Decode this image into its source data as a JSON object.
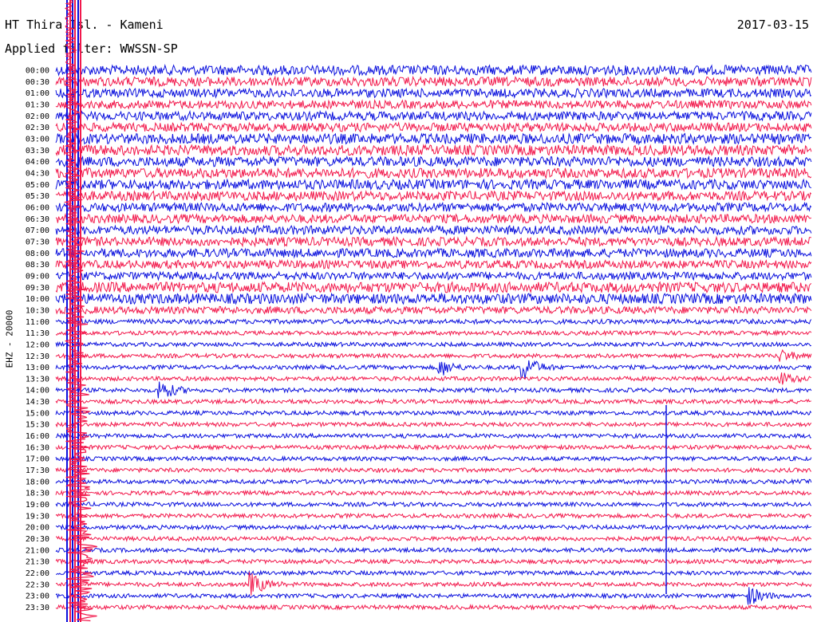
{
  "header": {
    "station": "HT Thira Isl. - Kameni",
    "date": "2017-03-15",
    "filter": "Applied filter: WWSSN-SP"
  },
  "chart_data": {
    "type": "line",
    "channel_label": "EHZ - 20000",
    "row_labels": [
      "00:00",
      "00:30",
      "01:00",
      "01:30",
      "02:00",
      "02:30",
      "03:00",
      "03:30",
      "04:00",
      "04:30",
      "05:00",
      "05:30",
      "06:00",
      "06:30",
      "07:00",
      "07:30",
      "08:00",
      "08:30",
      "09:00",
      "09:30",
      "10:00",
      "10:30",
      "11:00",
      "11:30",
      "12:00",
      "12:30",
      "13:00",
      "13:30",
      "14:00",
      "14:30",
      "15:00",
      "15:30",
      "16:00",
      "16:30",
      "17:00",
      "17:30",
      "18:00",
      "18:30",
      "19:00",
      "19:30",
      "20:00",
      "20:30",
      "21:00",
      "21:30",
      "22:00",
      "22:30",
      "23:00",
      "23:30"
    ],
    "colors": {
      "even_rows": "#0a10dd",
      "odd_rows": "#f2194c"
    },
    "noise_level": [
      0.95,
      0.9,
      0.85,
      0.8,
      0.85,
      0.85,
      1.0,
      1.0,
      0.95,
      0.95,
      0.95,
      0.9,
      0.85,
      0.85,
      0.85,
      0.85,
      0.85,
      0.8,
      0.75,
      1.0,
      1.0,
      0.7,
      0.45,
      0.4,
      0.4,
      0.4,
      0.4,
      0.4,
      0.4,
      0.4,
      0.4,
      0.4,
      0.4,
      0.4,
      0.4,
      0.4,
      0.4,
      0.4,
      0.4,
      0.4,
      0.4,
      0.4,
      0.4,
      0.4,
      0.4,
      0.4,
      0.4,
      0.4
    ],
    "events": [
      {
        "row": 26,
        "time_fraction": 0.62,
        "amplitude": 2.5
      },
      {
        "row": 26,
        "time_fraction": 0.51,
        "amplitude": 1.6
      },
      {
        "row": 28,
        "time_fraction": 0.14,
        "amplitude": 2.0
      },
      {
        "row": 45,
        "time_fraction": 0.26,
        "amplitude": 2.2
      },
      {
        "row": 46,
        "time_fraction": 0.92,
        "amplitude": 1.6
      },
      {
        "row": 27,
        "time_fraction": 0.96,
        "amplitude": 1.2
      },
      {
        "row": 25,
        "time_fraction": 0.96,
        "amplitude": 1.1
      }
    ],
    "large_event": {
      "row": 0,
      "time_fraction": 0.0,
      "note": "teleseismic arrival saturating traces"
    },
    "grid": false,
    "legend": "none"
  }
}
